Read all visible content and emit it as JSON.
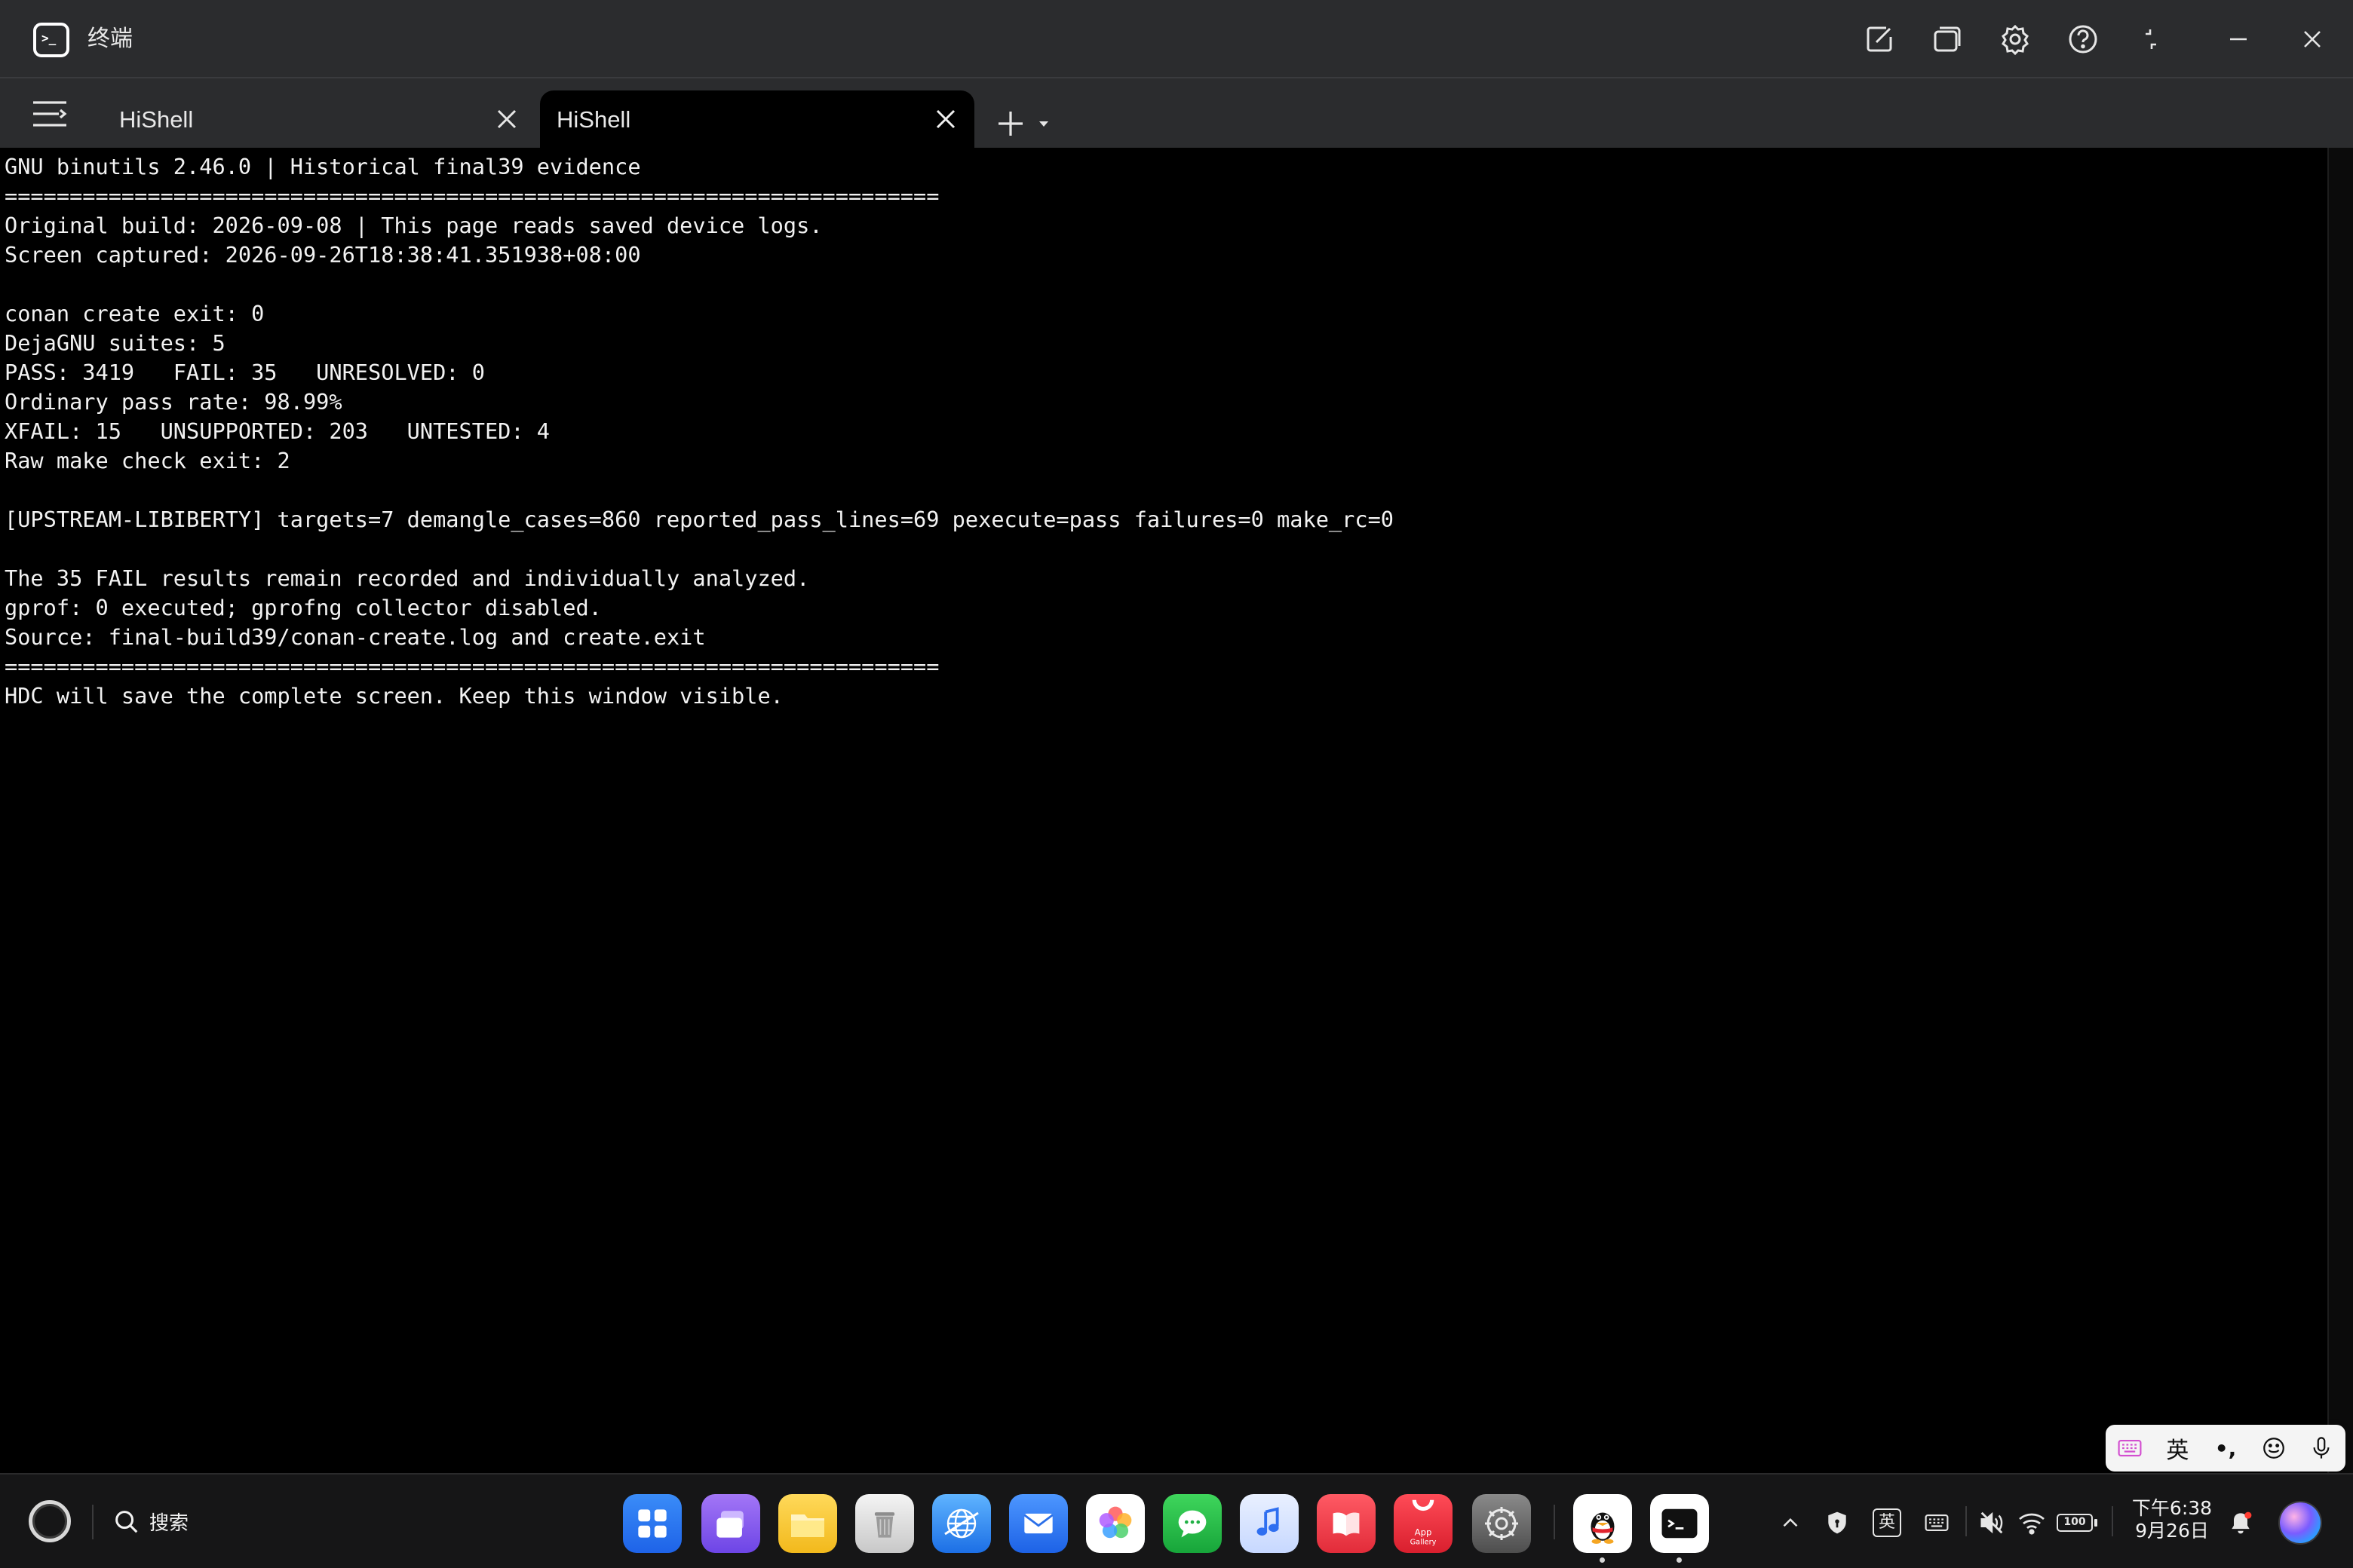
{
  "window": {
    "title": "终端",
    "app_icon_glyph": ">_"
  },
  "title_bar_buttons": [
    {
      "name": "edit-icon"
    },
    {
      "name": "window-overlap-icon"
    },
    {
      "name": "settings-icon"
    },
    {
      "name": "help-icon"
    },
    {
      "name": "restore-icon"
    },
    {
      "name": "minimize-icon"
    },
    {
      "name": "close-icon"
    }
  ],
  "tabs": [
    {
      "label": "HiShell",
      "active": false
    },
    {
      "label": "HiShell",
      "active": true
    }
  ],
  "terminal": {
    "lines": [
      "GNU binutils 2.46.0 | Historical final39 evidence",
      "========================================================================",
      "Original build: 2026-09-08 | This page reads saved device logs.",
      "Screen captured: 2026-09-26T18:38:41.351938+08:00",
      "",
      "conan create exit: 0",
      "DejaGNU suites: 5",
      "PASS: 3419   FAIL: 35   UNRESOLVED: 0",
      "Ordinary pass rate: 98.99%",
      "XFAIL: 15   UNSUPPORTED: 203   UNTESTED: 4",
      "Raw make check exit: 2",
      "",
      "[UPSTREAM-LIBIBERTY] targets=7 demangle_cases=860 reported_pass_lines=69 pexecute=pass failures=0 make_rc=0",
      "",
      "The 35 FAIL results remain recorded and individually analyzed.",
      "gprof: 0 executed; gprofng collector disabled.",
      "Source: final-build39/conan-create.log and create.exit",
      "========================================================================",
      "HDC will save the complete screen. Keep this window visible."
    ]
  },
  "ime_toolbar": {
    "lang_label": "英",
    "punct_label": "•,"
  },
  "taskbar": {
    "search_label": "搜索",
    "dock_apps": [
      {
        "name": "app-launcher",
        "color": "#2d7cf6"
      },
      {
        "name": "multitask",
        "color": "#8a5cf0"
      },
      {
        "name": "files",
        "color": "#f7c531"
      },
      {
        "name": "trash",
        "color": "#cfcfcf"
      },
      {
        "name": "browser",
        "color": "#2f86f2"
      },
      {
        "name": "mail",
        "color": "#2a7bf3"
      },
      {
        "name": "photos",
        "color": "#ffffff"
      },
      {
        "name": "messages",
        "color": "#2fc24a"
      },
      {
        "name": "music",
        "color": "#4e86ee"
      },
      {
        "name": "books",
        "color": "#f0404a"
      },
      {
        "name": "app-gallery",
        "color": "#e8333f",
        "label": "App\nGallery"
      },
      {
        "name": "settings",
        "color": "#6b6b6b"
      },
      {
        "name": "qq",
        "color": "#ffffff"
      },
      {
        "name": "terminal",
        "color": "#ffffff"
      }
    ],
    "tray": {
      "ime_label": "英",
      "battery_label": "100"
    },
    "clock": {
      "time": "下午6:38",
      "date": "9月26日"
    }
  }
}
